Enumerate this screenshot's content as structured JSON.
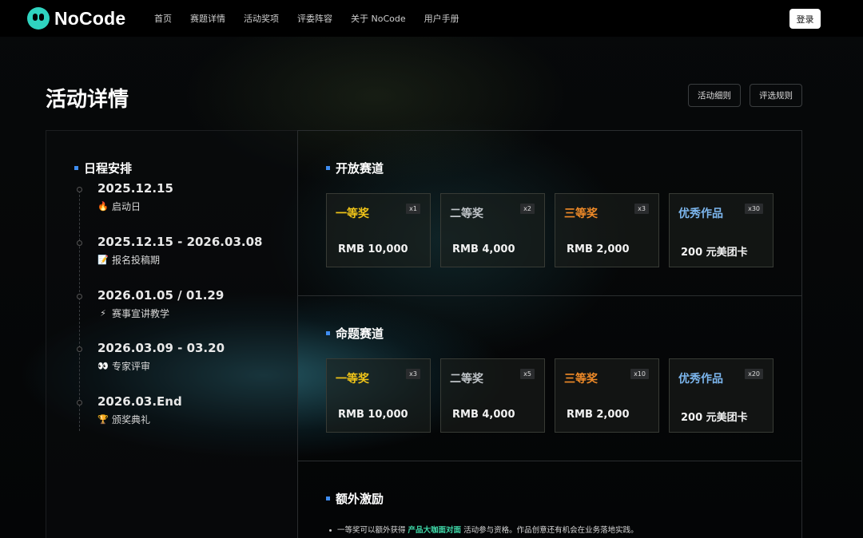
{
  "nav": {
    "logo_text": "NoCode",
    "links": [
      "首页",
      "赛题详情",
      "活动奖项",
      "评委阵容",
      "关于 NoCode",
      "用户手册"
    ],
    "login_label": "登录"
  },
  "header": {
    "title": "活动详情",
    "rules_label": "活动细则",
    "judging_label": "评选规则"
  },
  "schedule": {
    "title": "日程安排",
    "items": [
      {
        "date": "2025.12.15",
        "icon": "🔥",
        "label": "启动日"
      },
      {
        "date": "2025.12.15 - 2026.03.08",
        "icon": "📝",
        "label": "报名投稿期"
      },
      {
        "date": "2026.01.05 / 01.29",
        "icon": "⚡",
        "label": "赛事宣讲教学"
      },
      {
        "date": "2026.03.09 - 03.20",
        "icon": "👀",
        "label": "专家评审"
      },
      {
        "date": "2026.03.End",
        "icon": "🏆",
        "label": "颁奖典礼"
      }
    ]
  },
  "open_track": {
    "title": "开放赛道",
    "prizes": [
      {
        "name": "一等奖",
        "count": "x1",
        "amount": "RMB 10,000"
      },
      {
        "name": "二等奖",
        "count": "x2",
        "amount": "RMB 4,000"
      },
      {
        "name": "三等奖",
        "count": "x3",
        "amount": "RMB 2,000"
      },
      {
        "name": "优秀作品",
        "count": "x30",
        "amount": "200 元美团卡"
      }
    ]
  },
  "theme_track": {
    "title": "命题赛道",
    "prizes": [
      {
        "name": "一等奖",
        "count": "x3",
        "amount": "RMB 10,000"
      },
      {
        "name": "二等奖",
        "count": "x5",
        "amount": "RMB 4,000"
      },
      {
        "name": "三等奖",
        "count": "x10",
        "amount": "RMB 2,000"
      },
      {
        "name": "优秀作品",
        "count": "x20",
        "amount": "200 元美团卡"
      }
    ]
  },
  "bonus": {
    "title": "额外激励",
    "text_before": "一等奖可以额外获得",
    "highlight": "产品大咖面对面",
    "text_after": "活动参与资格。作品创意还有机会在业务落地实践。"
  },
  "colors": {
    "accent_blue": "#3f8df0",
    "gold": "#f0c418",
    "silver": "#bfc4c8",
    "bronze": "#ef8a28",
    "excellent": "#7cb6ee",
    "highlight_green": "#3fd8a8"
  }
}
